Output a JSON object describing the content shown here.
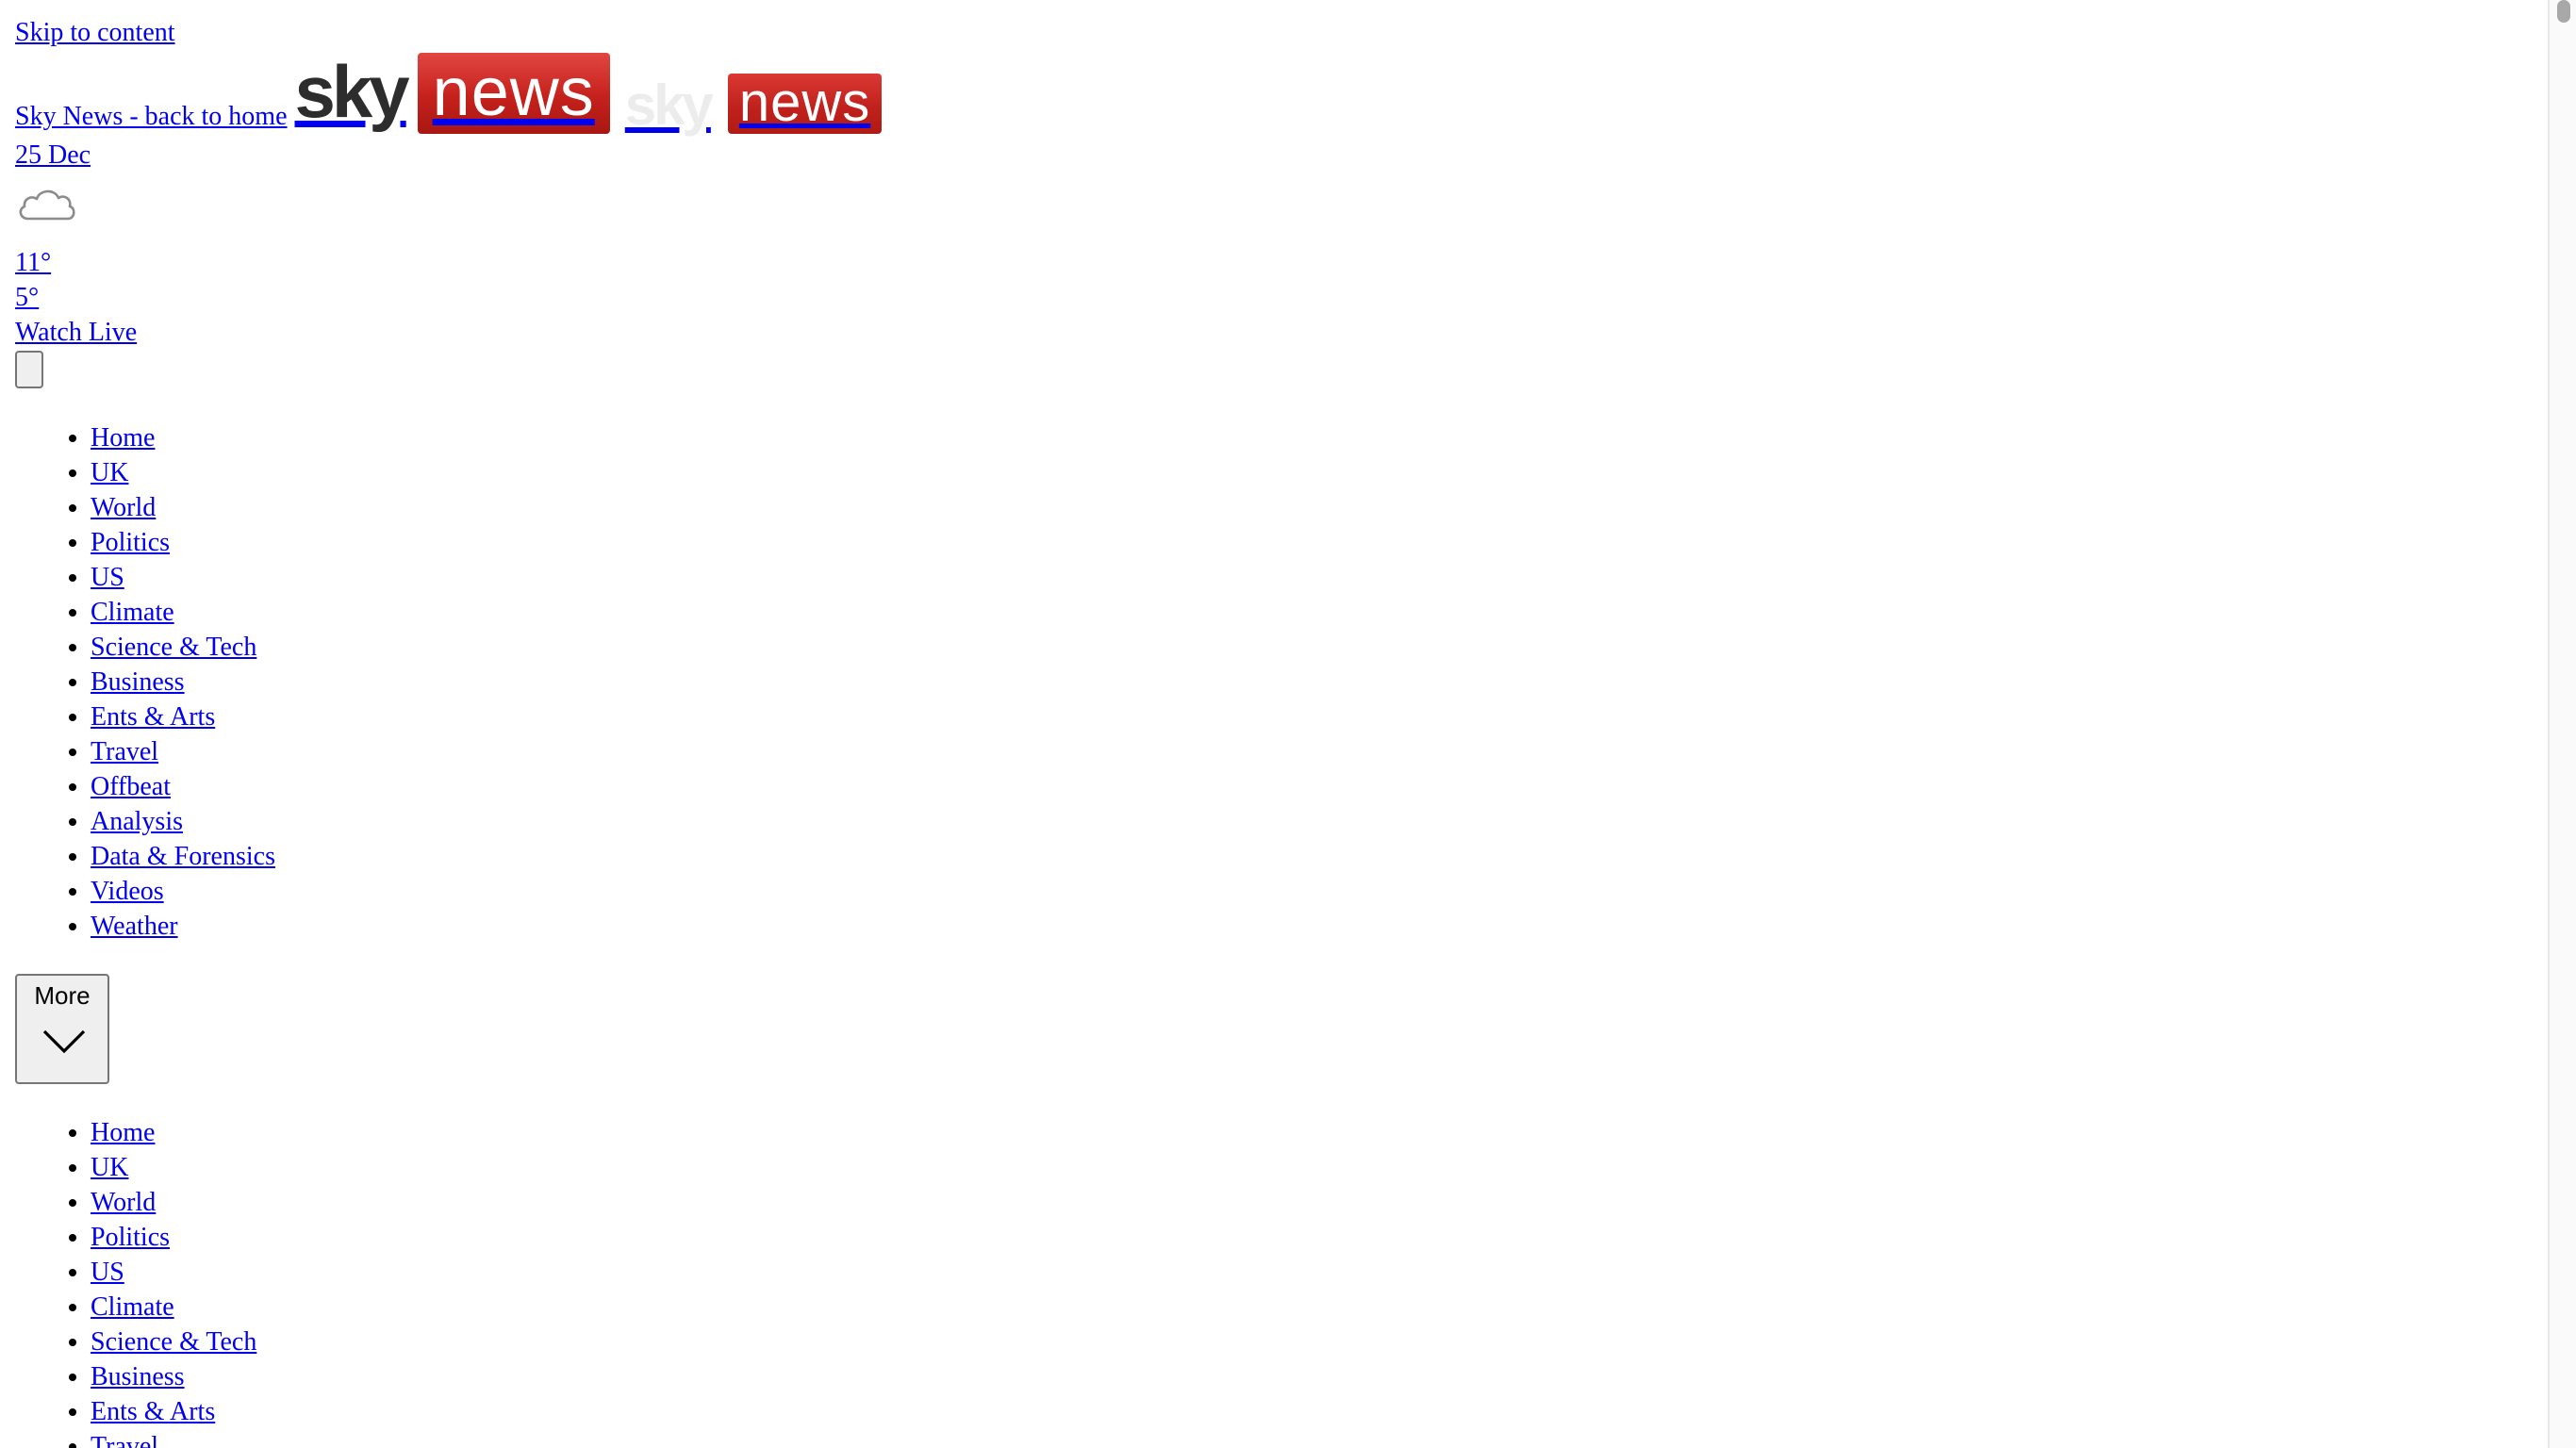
{
  "skip_link": "Skip to content",
  "header": {
    "home_link": "Sky News - back to home",
    "logo_primary": {
      "sky": "sky",
      "news": "news"
    },
    "logo_secondary": {
      "sky": "sky",
      "news": "news"
    },
    "brand_color": "#c5211c"
  },
  "weather": {
    "date": "25 Dec",
    "icon": "cloud-icon",
    "high": "11°",
    "low": "5°"
  },
  "watch_live": "Watch Live",
  "nav_primary": [
    "Home",
    "UK",
    "World",
    "Politics",
    "US",
    "Climate",
    "Science & Tech",
    "Business",
    "Ents & Arts",
    "Travel",
    "Offbeat",
    "Analysis",
    "Data & Forensics",
    "Videos",
    "Weather"
  ],
  "more_button": {
    "label": "More",
    "icon": "chevron-down-icon"
  },
  "nav_secondary": [
    "Home",
    "UK",
    "World",
    "Politics",
    "US",
    "Climate",
    "Science & Tech",
    "Business",
    "Ents & Arts",
    "Travel"
  ]
}
